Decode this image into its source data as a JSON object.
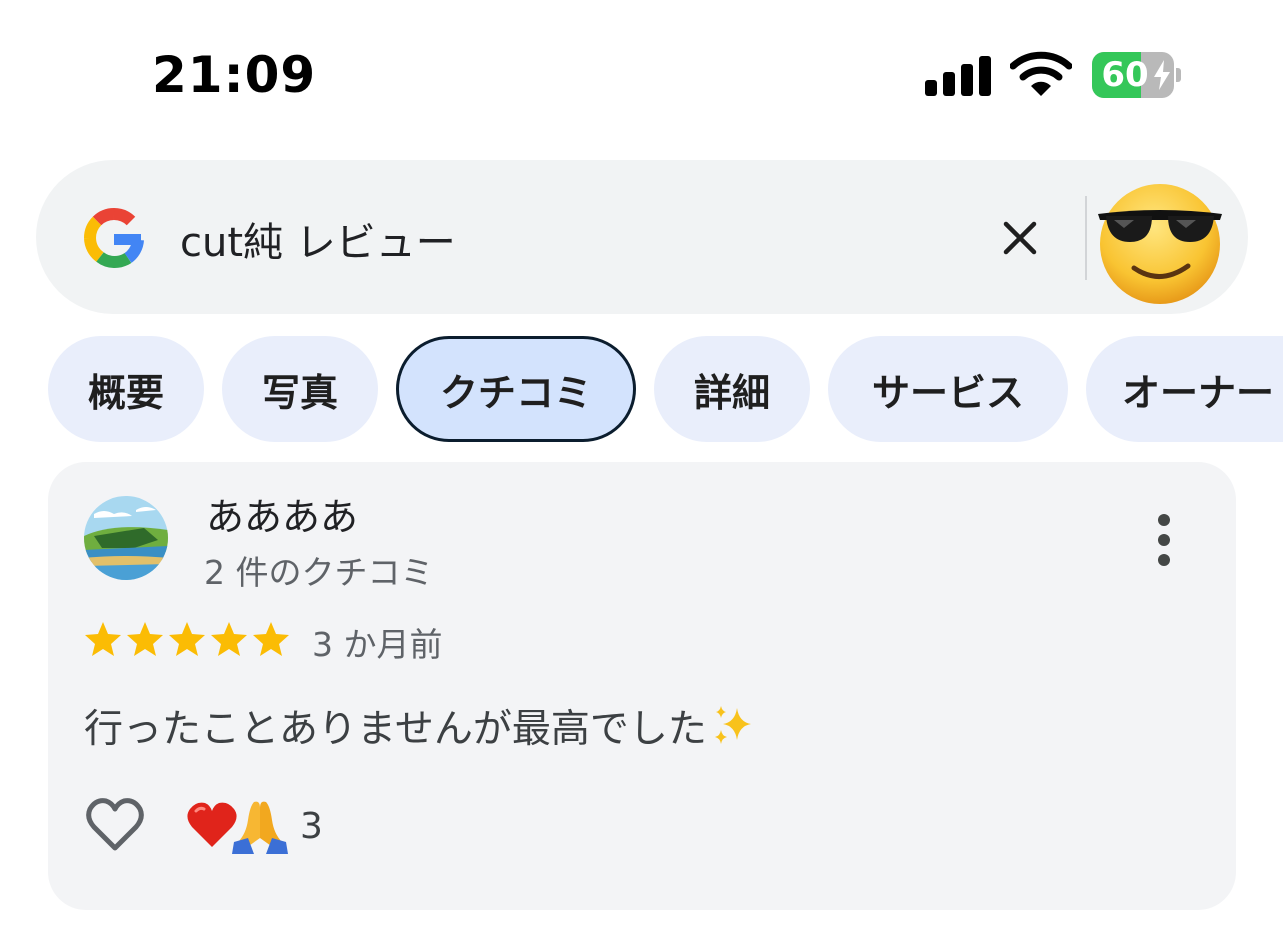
{
  "status_bar": {
    "time": "21:09",
    "battery_percent": "60",
    "battery_level": 0.6,
    "charging": true,
    "icons": [
      "signal-icon",
      "wifi-icon",
      "battery-icon"
    ]
  },
  "search": {
    "query": "cut純 レビュー",
    "icons": [
      "google-logo",
      "close-icon",
      "sunglasses-emoji-avatar"
    ]
  },
  "tabs": [
    {
      "label": "概要",
      "active": false
    },
    {
      "label": "写真",
      "active": false
    },
    {
      "label": "クチコミ",
      "active": true
    },
    {
      "label": "詳細",
      "active": false
    },
    {
      "label": "サービス",
      "active": false
    },
    {
      "label": "オーナー",
      "active": false
    }
  ],
  "review": {
    "author": "ああああ",
    "author_reviews": "2 件のクチコミ",
    "rating": 5,
    "rating_max": 5,
    "time_ago": "3 か月前",
    "text": "行ったことありませんが最高でした",
    "text_emoji": "sparkles",
    "reactions": [
      "red-heart-emoji",
      "folded-hands-emoji"
    ],
    "reaction_count": "3"
  },
  "colors": {
    "star": "#fbbc04",
    "chip_bg": "#e9eefb",
    "chip_active_bg": "#d3e3fd",
    "card_bg": "#f3f4f6",
    "battery_green": "#34c759"
  }
}
